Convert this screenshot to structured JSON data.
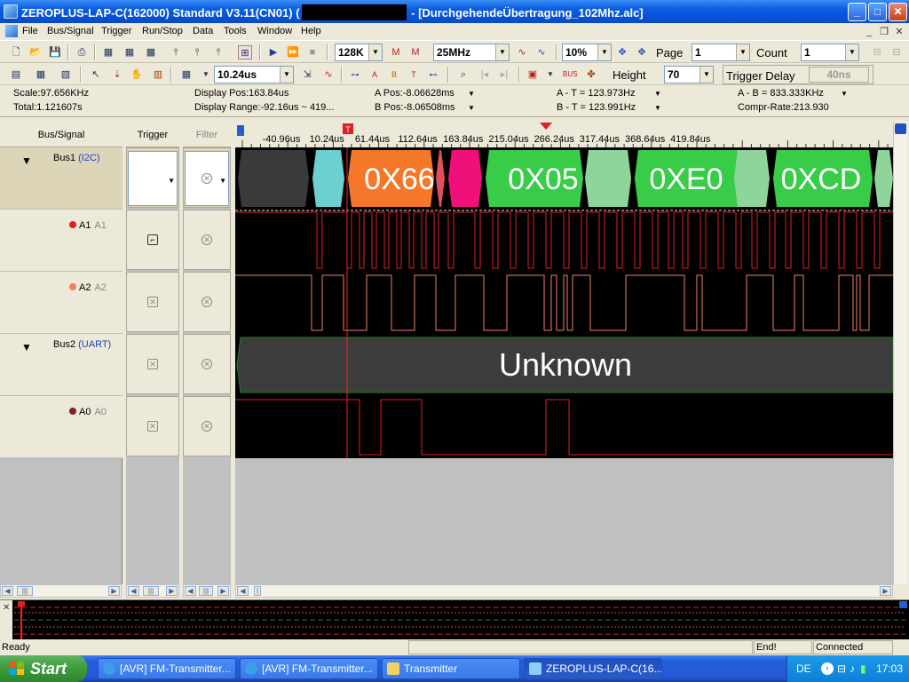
{
  "window": {
    "title_prefix": "ZEROPLUS-LAP-C(162000) Standard V3.11(CN01) (",
    "title_suffix": " - [DurchgehendeÜbertragung_102Mhz.alc]",
    "min": "_",
    "max": "□",
    "close": "✕"
  },
  "menu": [
    "File",
    "Bus/Signal",
    "Trigger",
    "Run/Stop",
    "Data",
    "Tools",
    "Window",
    "Help"
  ],
  "toolbar": {
    "memory": "128K",
    "sample_rate": "25MHz",
    "zoom": "10%",
    "page_label": "Page",
    "page_value": "1",
    "count_label": "Count",
    "count_value": "1",
    "time_per_div": "10.24us",
    "height_label": "Height",
    "height_value": "70",
    "trigger_delay_label": "Trigger Delay",
    "trigger_delay_value": "40ns"
  },
  "info": {
    "scale": "Scale:97.656KHz",
    "total": "Total:1.121607s",
    "display_pos": "Display Pos:163.84us",
    "display_range": "Display Range:-92.16us ~ 419...",
    "a_pos": "A Pos:-8.06628ms",
    "b_pos": "B Pos:-8.06508ms",
    "a_t": "A - T = 123.973Hz",
    "b_t": "B - T = 123.991Hz",
    "a_b": "A - B = 833.333KHz",
    "compr": "Compr-Rate:213.930"
  },
  "columns": {
    "bus_signal": "Bus/Signal",
    "trigger": "Trigger",
    "filter": "Filter"
  },
  "signals": [
    {
      "name": "Bus1",
      "sub": "(I2C)",
      "type": "bus"
    },
    {
      "name": "A1",
      "alias": "A1",
      "color": "#e02020",
      "type": "signal"
    },
    {
      "name": "A2",
      "alias": "A2",
      "color": "#f08060",
      "type": "signal"
    },
    {
      "name": "Bus2",
      "sub": "(UART)",
      "type": "bus"
    },
    {
      "name": "A0",
      "alias": "A0",
      "color": "#802020",
      "type": "signal"
    }
  ],
  "ruler_ticks": [
    "-40.96us",
    "10.24us",
    "61.44us",
    "112.64us",
    "163.84us",
    "215.04us",
    "266.24us",
    "317.44us",
    "368.64us",
    "419.84us"
  ],
  "marker_T": "T",
  "i2c_decodes": [
    "0X66",
    "0X05",
    "0XE0",
    "0XCD"
  ],
  "uart_decode": "Unknown",
  "status": {
    "ready": "Ready",
    "end": "End!",
    "connected": "Connected"
  },
  "taskbar": {
    "start": "Start",
    "tasks": [
      "[AVR] FM-Transmitter...",
      "[AVR] FM-Transmitter...",
      "Transmitter",
      "ZEROPLUS-LAP-C(16..."
    ],
    "lang": "DE",
    "clock": "17:03"
  },
  "colors": {
    "i2c_orange": "#f5782a",
    "i2c_green": "#38cc48",
    "i2c_pink": "#f0107a",
    "i2c_cyan": "#6ccfd0",
    "wave_red": "#e02020",
    "wave_orange": "#f08060"
  }
}
